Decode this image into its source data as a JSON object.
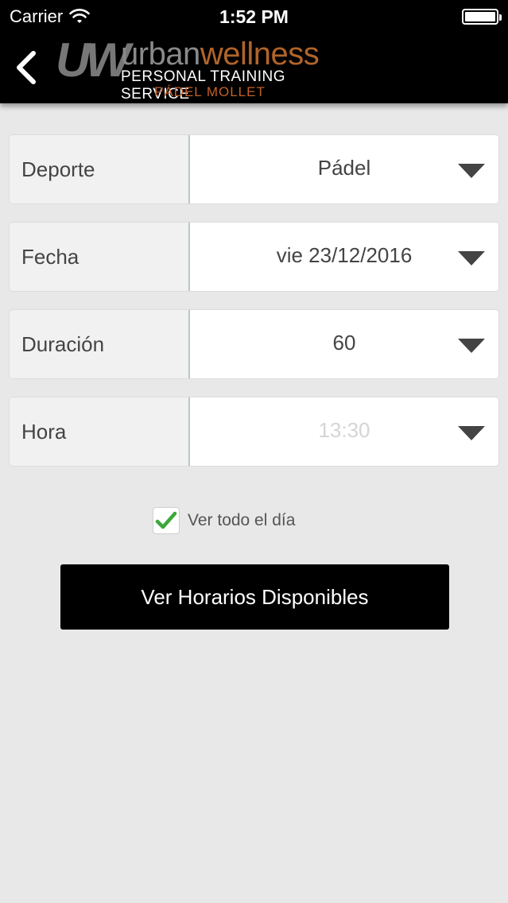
{
  "status_bar": {
    "carrier": "Carrier",
    "time": "1:52 PM",
    "wifi_icon": "wifi-icon",
    "battery_icon": "battery-icon"
  },
  "nav": {
    "back_icon": "chevron-left-icon",
    "logo": {
      "mark": "UW",
      "brand_part1": "urban",
      "brand_part2": "wellness",
      "tagline": "PERSONAL TRAINING SERVICE",
      "subtitle": "PÁDEL MOLLET"
    }
  },
  "form": {
    "rows": [
      {
        "label": "Deporte",
        "value": "Pádel",
        "disabled": false
      },
      {
        "label": "Fecha",
        "value": "vie 23/12/2016",
        "disabled": false
      },
      {
        "label": "Duración",
        "value": "60",
        "disabled": false
      },
      {
        "label": "Hora",
        "value": "13:30",
        "disabled": true
      }
    ],
    "caret_icon": "caret-down-icon"
  },
  "all_day": {
    "label": "Ver todo el día",
    "checked": true,
    "check_color": "#3aa83a"
  },
  "submit": {
    "label": "Ver Horarios Disponibles"
  },
  "colors": {
    "background": "#e8e8e8",
    "bars": "#000000",
    "brand_orange": "#c2612a",
    "label_bg": "#f1f1f1",
    "divider": "#b8c8cc"
  }
}
